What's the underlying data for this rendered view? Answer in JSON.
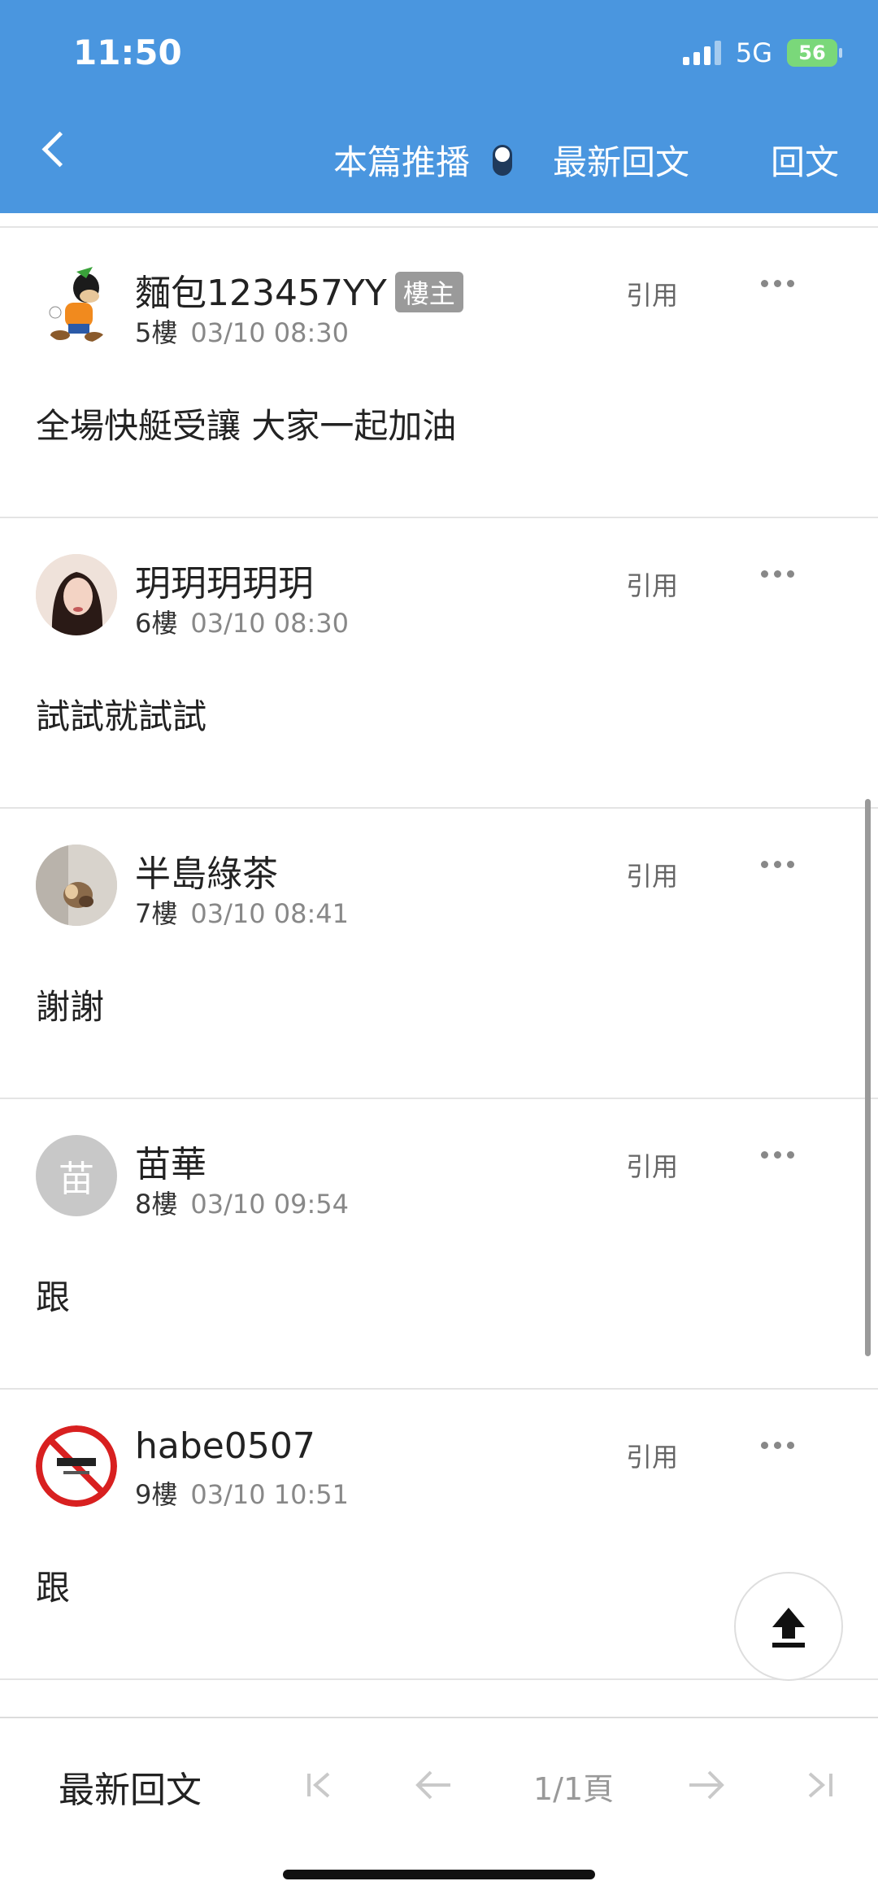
{
  "status_bar": {
    "time": "11:50",
    "network": "5G",
    "battery": "56"
  },
  "nav": {
    "broadcast_label": "本篇推播",
    "latest_label": "最新回文",
    "reply_label": "回文"
  },
  "posts": [
    {
      "username": "麵包123457YY",
      "badge": "樓主",
      "floor": "5樓",
      "time": "03/10 08:30",
      "content": "全場快艇受讓 大家一起加油",
      "quote": "引用",
      "avatar_char": ""
    },
    {
      "username": "玥玥玥玥玥",
      "badge": "",
      "floor": "6樓",
      "time": "03/10 08:30",
      "content": "試試就試試",
      "quote": "引用",
      "avatar_char": ""
    },
    {
      "username": "半島綠茶",
      "badge": "",
      "floor": "7樓",
      "time": "03/10 08:41",
      "content": "謝謝",
      "quote": "引用",
      "avatar_char": ""
    },
    {
      "username": "苗華",
      "badge": "",
      "floor": "8樓",
      "time": "03/10 09:54",
      "content": "跟",
      "quote": "引用",
      "avatar_char": "苗"
    },
    {
      "username": "habe0507",
      "badge": "",
      "floor": "9樓",
      "time": "03/10 10:51",
      "content": "跟",
      "quote": "引用",
      "avatar_char": ""
    }
  ],
  "bottom_bar": {
    "latest_label": "最新回文",
    "page_indicator": "1/1頁"
  },
  "colors": {
    "header_bg": "#4a96df",
    "divider": "#e4e4e4",
    "badge_bg": "#9a9a9a"
  }
}
